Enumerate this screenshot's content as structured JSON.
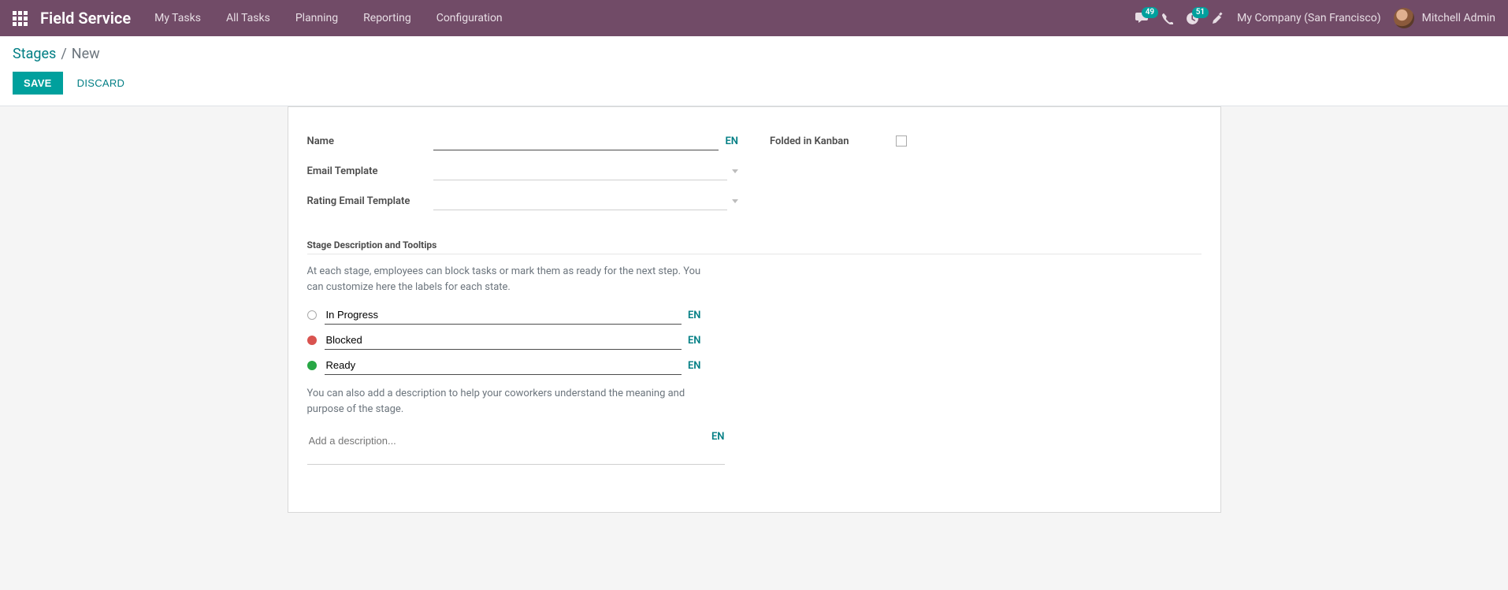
{
  "navbar": {
    "brand": "Field Service",
    "menu": [
      "My Tasks",
      "All Tasks",
      "Planning",
      "Reporting",
      "Configuration"
    ],
    "messages_badge": "49",
    "activities_badge": "51",
    "company": "My Company (San Francisco)",
    "user_name": "Mitchell Admin"
  },
  "breadcrumb": {
    "parent": "Stages",
    "separator": "/",
    "current": "New"
  },
  "actions": {
    "save": "SAVE",
    "discard": "DISCARD"
  },
  "form": {
    "name_label": "Name",
    "name_value": "",
    "name_lang": "EN",
    "email_template_label": "Email Template",
    "email_template_value": "",
    "rating_template_label": "Rating Email Template",
    "rating_template_value": "",
    "folded_label": "Folded in Kanban",
    "folded_checked": false
  },
  "section": {
    "title": "Stage Description and Tooltips",
    "help1": "At each stage, employees can block tasks or mark them as ready for the next step. You can customize here the labels for each state.",
    "states": [
      {
        "color": "grey",
        "label": "In Progress",
        "lang": "EN"
      },
      {
        "color": "red",
        "label": "Blocked",
        "lang": "EN"
      },
      {
        "color": "green",
        "label": "Ready",
        "lang": "EN"
      }
    ],
    "help2": "You can also add a description to help your coworkers understand the meaning and purpose of the stage.",
    "description_placeholder": "Add a description...",
    "description_lang": "EN"
  }
}
